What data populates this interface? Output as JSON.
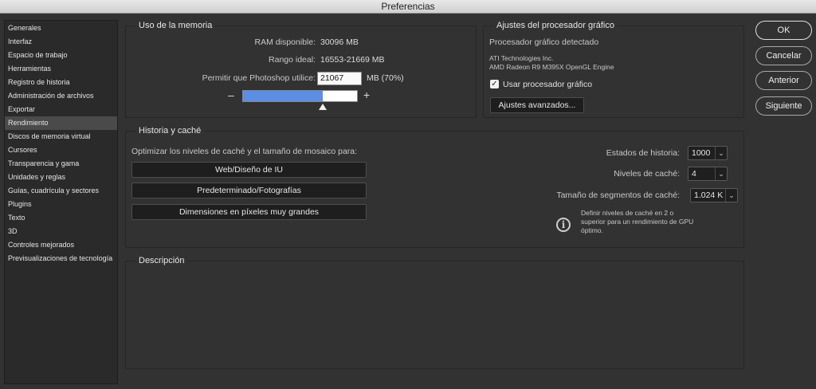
{
  "window": {
    "title": "Preferencias"
  },
  "sidebar": {
    "items": [
      {
        "label": "Generales"
      },
      {
        "label": "Interfaz"
      },
      {
        "label": "Espacio de trabajo"
      },
      {
        "label": "Herramientas"
      },
      {
        "label": "Registro de historia"
      },
      {
        "label": "Administración de archivos"
      },
      {
        "label": "Exportar"
      },
      {
        "label": "Rendimiento"
      },
      {
        "label": "Discos de memoria virtual"
      },
      {
        "label": "Cursores"
      },
      {
        "label": "Transparencia y gama"
      },
      {
        "label": "Unidades y reglas"
      },
      {
        "label": "Guías, cuadrícula y sectores"
      },
      {
        "label": "Plugins"
      },
      {
        "label": "Texto"
      },
      {
        "label": "3D"
      },
      {
        "label": "Controles mejorados"
      },
      {
        "label": "Previsualizaciones de tecnología"
      }
    ],
    "selected": "Rendimiento"
  },
  "memory": {
    "title": "Uso de la memoria",
    "ram_label": "RAM disponible:",
    "ram_value": "30096 MB",
    "ideal_label": "Rango ideal:",
    "ideal_value": "16553-21669 MB",
    "allow_label": "Permitir que Photoshop utilice:",
    "allow_value": "21067",
    "allow_unit": "MB (70%)",
    "slider_fraction": 0.7,
    "minus": "–",
    "plus": "+"
  },
  "gpu": {
    "title": "Ajustes del procesador gráfico",
    "detected_label": "Procesador gráfico detectado",
    "vendor": "ATI Technologies Inc.",
    "model": "AMD Radeon R9 M395X OpenGL Engine",
    "use_gpu_label": "Usar procesador gráfico",
    "use_gpu_checked": true,
    "advanced_button": "Ajustes avanzados..."
  },
  "cache": {
    "title": "Historia y caché",
    "optimize_label": "Optimizar los niveles de caché y el tamaño de mosaico para:",
    "buttons": [
      "Web/Diseño de IU",
      "Predeterminado/Fotografías",
      "Dimensiones en píxeles muy grandes"
    ],
    "history_label": "Estados de historia:",
    "history_value": "1000",
    "levels_label": "Niveles de caché:",
    "levels_value": "4",
    "tile_label": "Tamaño de segmentos de caché:",
    "tile_value": "1.024 K",
    "info_line1": "Definir niveles de caché en 2 o",
    "info_line2": "superior para un rendimiento de GPU",
    "info_line3": "óptimo."
  },
  "description": {
    "title": "Descripción"
  },
  "actions": {
    "ok": "OK",
    "cancel": "Cancelar",
    "previous": "Anterior",
    "next": "Siguiente"
  },
  "colors": {
    "slider_fill": "#5b8fe6",
    "background": "#323232"
  }
}
